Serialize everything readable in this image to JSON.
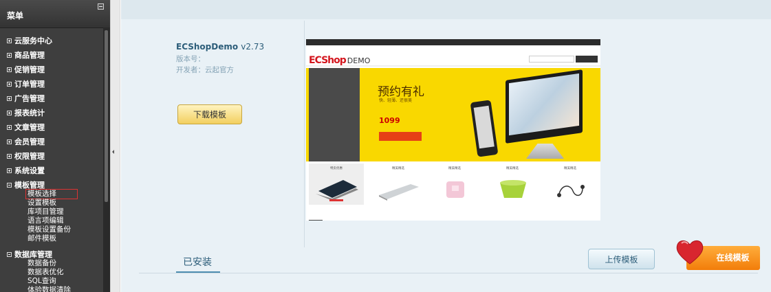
{
  "sidebar": {
    "title": "菜单",
    "menus": [
      {
        "label": "云服务中心"
      },
      {
        "label": "商品管理"
      },
      {
        "label": "促销管理"
      },
      {
        "label": "订单管理"
      },
      {
        "label": "广告管理"
      },
      {
        "label": "报表统计"
      },
      {
        "label": "文章管理"
      },
      {
        "label": "会员管理"
      },
      {
        "label": "权限管理"
      },
      {
        "label": "系统设置"
      },
      {
        "label": "模板管理"
      },
      {
        "label": "数据库管理"
      }
    ],
    "template_subitems": [
      "模板选择",
      "设置模板",
      "库项目管理",
      "语言项编辑",
      "模板设置备份",
      "邮件模板"
    ],
    "database_subitems": [
      "数据备份",
      "数据表优化",
      "SQL查询",
      "体验数据清除"
    ]
  },
  "template": {
    "name": "ECShopDemo",
    "version": "v2.73",
    "version_label": "版本号：",
    "developer_label": "开发者：云起官方",
    "download_button": "下载模板"
  },
  "preview": {
    "logo": "ECShop",
    "logo_suffix": "DEMO",
    "headline": "预约有礼",
    "subline": "快、轻薄、还很美",
    "price": "1099",
    "products": [
      "特卖优惠",
      "精美精选",
      "精美精选",
      "精美精选",
      "精美精选"
    ]
  },
  "tabs": {
    "installed": "已安装"
  },
  "actions": {
    "upload_button": "上传模板",
    "online_button": "在线模板"
  },
  "colors": {
    "sidebar_bg": "#3e3e3e",
    "main_bg": "#e9f1f6",
    "link_blue": "#2c5d79",
    "online_orange": "#f27d0a",
    "heart_red": "#d8262f"
  }
}
